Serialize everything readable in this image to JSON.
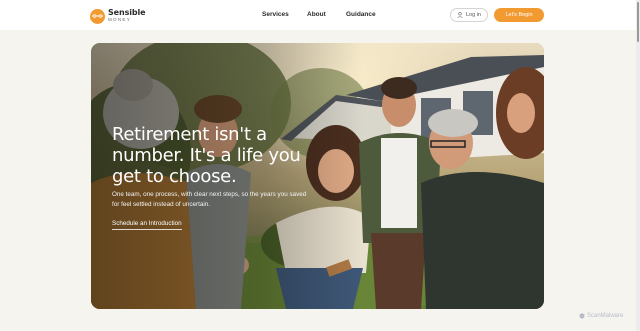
{
  "brand": {
    "name": "Sensible",
    "sub": "MONEY",
    "accent": "#f29a32"
  },
  "nav": {
    "items": [
      "Services",
      "About",
      "Guidance"
    ]
  },
  "header": {
    "login_label": "Log in",
    "cta_label": "Let's Begin"
  },
  "hero": {
    "headline": "Retirement isn't a number. It's a life you get to choose.",
    "subtext": "One team, one process, with clear next steps, so the years you saved for feel settled instead of uncertain.",
    "link_label": "Schedule an Introduction",
    "image": "photo-family-laughing-outdoors"
  },
  "watermark": "ScanMalware",
  "icons": [
    "logo-mark-icon",
    "person-icon",
    "shield-icon"
  ]
}
